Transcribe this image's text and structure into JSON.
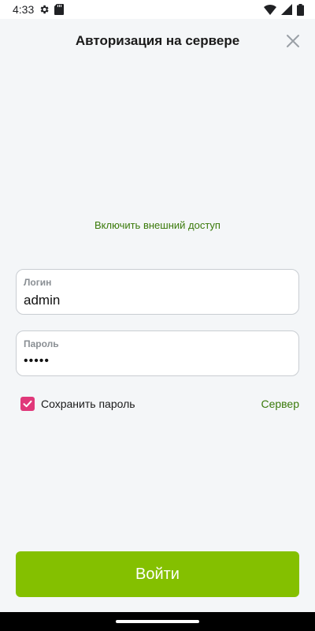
{
  "status_bar": {
    "time": "4:33",
    "icons": [
      "gear-icon",
      "sd-card-icon",
      "wifi-icon",
      "signal-icon",
      "battery-icon"
    ]
  },
  "header": {
    "title": "Авторизация на сервере",
    "close_icon": "close-icon"
  },
  "external_access": {
    "label": "Включить внешний доступ"
  },
  "form": {
    "login": {
      "label": "Логин",
      "value": "admin"
    },
    "password": {
      "label": "Пароль",
      "value": "•••••"
    },
    "remember": {
      "label": "Сохранить пароль",
      "checked": true
    },
    "server_link": "Сервер"
  },
  "submit": {
    "label": "Войти"
  },
  "colors": {
    "accent_green": "#84c000",
    "link_green": "#3a7a0a",
    "checkbox_pink": "#e0387a",
    "background": "#f4f6f8"
  }
}
